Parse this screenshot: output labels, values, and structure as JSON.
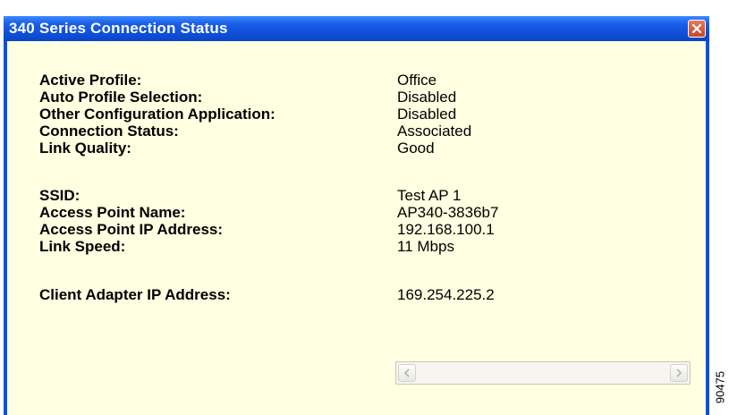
{
  "window": {
    "title": "340 Series Connection Status"
  },
  "status_fields": [
    {
      "label": "Active Profile:",
      "value": "Office"
    },
    {
      "label": "Auto Profile Selection:",
      "value": "Disabled"
    },
    {
      "label": "Other Configuration Application:",
      "value": "Disabled"
    },
    {
      "label": "Connection Status:",
      "value": "Associated"
    },
    {
      "label": "Link Quality:",
      "value": "Good"
    },
    {
      "label": "SSID:",
      "value": "Test AP 1"
    },
    {
      "label": "Access Point Name:",
      "value": "AP340-3836b7"
    },
    {
      "label": "Access Point IP Address:",
      "value": "192.168.100.1"
    },
    {
      "label": "Link Speed:",
      "value": "11 Mbps"
    },
    {
      "label": "Client Adapter IP Address:",
      "value": "169.254.225.2"
    }
  ],
  "figure_id": "90475",
  "icons": {
    "close": "close-icon",
    "scroll_left": "scroll-left-arrow-icon",
    "scroll_right": "scroll-right-arrow-icon"
  },
  "colors": {
    "titlebar": "#0a45c8",
    "client_bg": "#ffffe1",
    "close_button": "#c8452a"
  }
}
